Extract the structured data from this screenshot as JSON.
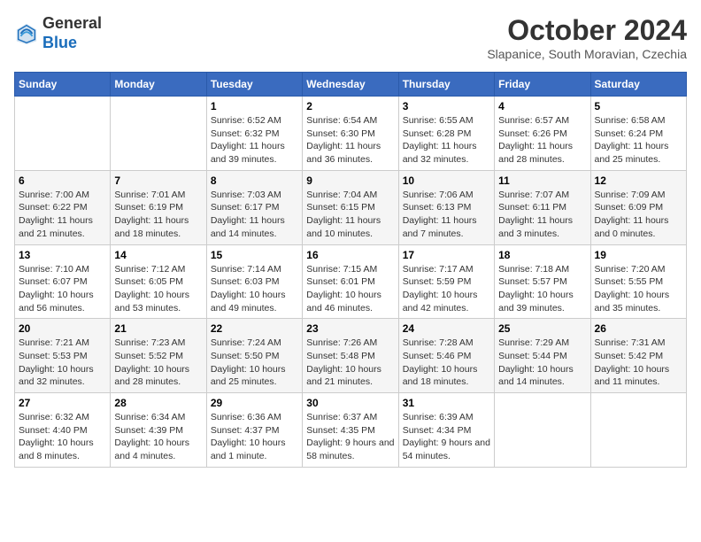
{
  "header": {
    "logo_line1": "General",
    "logo_line2": "Blue",
    "month": "October 2024",
    "location": "Slapanice, South Moravian, Czechia"
  },
  "weekdays": [
    "Sunday",
    "Monday",
    "Tuesday",
    "Wednesday",
    "Thursday",
    "Friday",
    "Saturday"
  ],
  "weeks": [
    [
      {
        "day": "",
        "sunrise": "",
        "sunset": "",
        "daylight": ""
      },
      {
        "day": "",
        "sunrise": "",
        "sunset": "",
        "daylight": ""
      },
      {
        "day": "1",
        "sunrise": "Sunrise: 6:52 AM",
        "sunset": "Sunset: 6:32 PM",
        "daylight": "Daylight: 11 hours and 39 minutes."
      },
      {
        "day": "2",
        "sunrise": "Sunrise: 6:54 AM",
        "sunset": "Sunset: 6:30 PM",
        "daylight": "Daylight: 11 hours and 36 minutes."
      },
      {
        "day": "3",
        "sunrise": "Sunrise: 6:55 AM",
        "sunset": "Sunset: 6:28 PM",
        "daylight": "Daylight: 11 hours and 32 minutes."
      },
      {
        "day": "4",
        "sunrise": "Sunrise: 6:57 AM",
        "sunset": "Sunset: 6:26 PM",
        "daylight": "Daylight: 11 hours and 28 minutes."
      },
      {
        "day": "5",
        "sunrise": "Sunrise: 6:58 AM",
        "sunset": "Sunset: 6:24 PM",
        "daylight": "Daylight: 11 hours and 25 minutes."
      }
    ],
    [
      {
        "day": "6",
        "sunrise": "Sunrise: 7:00 AM",
        "sunset": "Sunset: 6:22 PM",
        "daylight": "Daylight: 11 hours and 21 minutes."
      },
      {
        "day": "7",
        "sunrise": "Sunrise: 7:01 AM",
        "sunset": "Sunset: 6:19 PM",
        "daylight": "Daylight: 11 hours and 18 minutes."
      },
      {
        "day": "8",
        "sunrise": "Sunrise: 7:03 AM",
        "sunset": "Sunset: 6:17 PM",
        "daylight": "Daylight: 11 hours and 14 minutes."
      },
      {
        "day": "9",
        "sunrise": "Sunrise: 7:04 AM",
        "sunset": "Sunset: 6:15 PM",
        "daylight": "Daylight: 11 hours and 10 minutes."
      },
      {
        "day": "10",
        "sunrise": "Sunrise: 7:06 AM",
        "sunset": "Sunset: 6:13 PM",
        "daylight": "Daylight: 11 hours and 7 minutes."
      },
      {
        "day": "11",
        "sunrise": "Sunrise: 7:07 AM",
        "sunset": "Sunset: 6:11 PM",
        "daylight": "Daylight: 11 hours and 3 minutes."
      },
      {
        "day": "12",
        "sunrise": "Sunrise: 7:09 AM",
        "sunset": "Sunset: 6:09 PM",
        "daylight": "Daylight: 11 hours and 0 minutes."
      }
    ],
    [
      {
        "day": "13",
        "sunrise": "Sunrise: 7:10 AM",
        "sunset": "Sunset: 6:07 PM",
        "daylight": "Daylight: 10 hours and 56 minutes."
      },
      {
        "day": "14",
        "sunrise": "Sunrise: 7:12 AM",
        "sunset": "Sunset: 6:05 PM",
        "daylight": "Daylight: 10 hours and 53 minutes."
      },
      {
        "day": "15",
        "sunrise": "Sunrise: 7:14 AM",
        "sunset": "Sunset: 6:03 PM",
        "daylight": "Daylight: 10 hours and 49 minutes."
      },
      {
        "day": "16",
        "sunrise": "Sunrise: 7:15 AM",
        "sunset": "Sunset: 6:01 PM",
        "daylight": "Daylight: 10 hours and 46 minutes."
      },
      {
        "day": "17",
        "sunrise": "Sunrise: 7:17 AM",
        "sunset": "Sunset: 5:59 PM",
        "daylight": "Daylight: 10 hours and 42 minutes."
      },
      {
        "day": "18",
        "sunrise": "Sunrise: 7:18 AM",
        "sunset": "Sunset: 5:57 PM",
        "daylight": "Daylight: 10 hours and 39 minutes."
      },
      {
        "day": "19",
        "sunrise": "Sunrise: 7:20 AM",
        "sunset": "Sunset: 5:55 PM",
        "daylight": "Daylight: 10 hours and 35 minutes."
      }
    ],
    [
      {
        "day": "20",
        "sunrise": "Sunrise: 7:21 AM",
        "sunset": "Sunset: 5:53 PM",
        "daylight": "Daylight: 10 hours and 32 minutes."
      },
      {
        "day": "21",
        "sunrise": "Sunrise: 7:23 AM",
        "sunset": "Sunset: 5:52 PM",
        "daylight": "Daylight: 10 hours and 28 minutes."
      },
      {
        "day": "22",
        "sunrise": "Sunrise: 7:24 AM",
        "sunset": "Sunset: 5:50 PM",
        "daylight": "Daylight: 10 hours and 25 minutes."
      },
      {
        "day": "23",
        "sunrise": "Sunrise: 7:26 AM",
        "sunset": "Sunset: 5:48 PM",
        "daylight": "Daylight: 10 hours and 21 minutes."
      },
      {
        "day": "24",
        "sunrise": "Sunrise: 7:28 AM",
        "sunset": "Sunset: 5:46 PM",
        "daylight": "Daylight: 10 hours and 18 minutes."
      },
      {
        "day": "25",
        "sunrise": "Sunrise: 7:29 AM",
        "sunset": "Sunset: 5:44 PM",
        "daylight": "Daylight: 10 hours and 14 minutes."
      },
      {
        "day": "26",
        "sunrise": "Sunrise: 7:31 AM",
        "sunset": "Sunset: 5:42 PM",
        "daylight": "Daylight: 10 hours and 11 minutes."
      }
    ],
    [
      {
        "day": "27",
        "sunrise": "Sunrise: 6:32 AM",
        "sunset": "Sunset: 4:40 PM",
        "daylight": "Daylight: 10 hours and 8 minutes."
      },
      {
        "day": "28",
        "sunrise": "Sunrise: 6:34 AM",
        "sunset": "Sunset: 4:39 PM",
        "daylight": "Daylight: 10 hours and 4 minutes."
      },
      {
        "day": "29",
        "sunrise": "Sunrise: 6:36 AM",
        "sunset": "Sunset: 4:37 PM",
        "daylight": "Daylight: 10 hours and 1 minute."
      },
      {
        "day": "30",
        "sunrise": "Sunrise: 6:37 AM",
        "sunset": "Sunset: 4:35 PM",
        "daylight": "Daylight: 9 hours and 58 minutes."
      },
      {
        "day": "31",
        "sunrise": "Sunrise: 6:39 AM",
        "sunset": "Sunset: 4:34 PM",
        "daylight": "Daylight: 9 hours and 54 minutes."
      },
      {
        "day": "",
        "sunrise": "",
        "sunset": "",
        "daylight": ""
      },
      {
        "day": "",
        "sunrise": "",
        "sunset": "",
        "daylight": ""
      }
    ]
  ]
}
